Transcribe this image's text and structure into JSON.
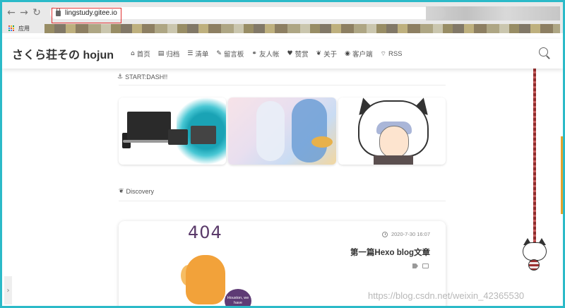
{
  "browser": {
    "url": "lingstudy.gitee.io",
    "bookmarks_label": "应用",
    "icons": {
      "back": "arrow-left-icon",
      "forward": "arrow-right-icon",
      "reload": "reload-icon",
      "lock": "lock-icon",
      "apps": "apps-grid-icon"
    },
    "colors": {
      "highlight_box": "#e03030"
    }
  },
  "site": {
    "title": "さくら荘その hojun",
    "nav": [
      {
        "label": "首页",
        "icon": "home-icon",
        "glyph": "⌂"
      },
      {
        "label": "归档",
        "icon": "archive-icon",
        "glyph": "▤"
      },
      {
        "label": "清单",
        "icon": "list-icon",
        "glyph": "☰"
      },
      {
        "label": "留言板",
        "icon": "edit-icon",
        "glyph": "✎"
      },
      {
        "label": "友人帐",
        "icon": "link-icon",
        "glyph": "⚭"
      },
      {
        "label": "赞赏",
        "icon": "heart-icon",
        "glyph": "♥"
      },
      {
        "label": "关于",
        "icon": "leaf-icon",
        "glyph": "❦"
      },
      {
        "label": "客户端",
        "icon": "android-icon",
        "glyph": "◉"
      },
      {
        "label": "RSS",
        "icon": "rss-icon",
        "glyph": "⌔"
      }
    ],
    "search_icon": "search-icon"
  },
  "startdash": {
    "title": "START:DASH!!",
    "icon": "anchor-icon"
  },
  "discovery": {
    "title": "Discovery",
    "icon": "leaf-icon",
    "post": {
      "image_text": "404",
      "bubble_text": "Houston, we have",
      "date": "2020-7-30 16:07",
      "title": "第一篇Hexo blog文章"
    }
  },
  "watermark": "https://blog.csdn.net/weixin_42365530"
}
